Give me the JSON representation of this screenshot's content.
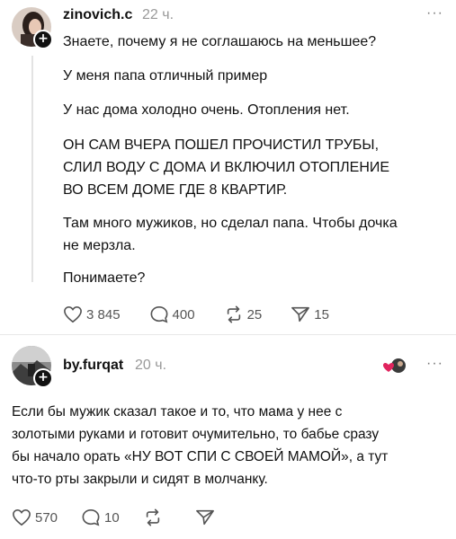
{
  "post1": {
    "username": "zinovich.c",
    "time": "22 ч.",
    "more": "···",
    "lines": [
      "Знаете, почему я не соглашаюсь на меньшее?",
      "У меня папа отличный пример",
      "У нас дома холодно очень. Отопления нет.",
      "ОН САМ ВЧЕРА ПОШЕЛ ПРОЧИСТИЛ ТРУБЫ,",
      "СЛИЛ ВОДУ С ДОМА И ВКЛЮЧИЛ ОТОПЛЕНИЕ",
      "ВО ВСЕМ ДОМЕ ГДЕ 8 КВАРТИР.",
      "Там много мужиков, но сделал папа. Чтобы дочка",
      "не мерзла.",
      "Понимаете?"
    ],
    "likes": "3 845",
    "comments": "400",
    "reposts": "25",
    "shares": "15"
  },
  "post2": {
    "username": "by.furqat",
    "time": "20 ч.",
    "more": "···",
    "lines": [
      "Если бы мужик сказал такое и то, что мама у нее с",
      "золотыми руками и готовит очумительно, то бабье сразу",
      "бы начало орать «НУ ВОТ СПИ С СВОЕЙ МАМОЙ», а тут",
      "что-то рты закрыли и сидят в молчанку."
    ],
    "likes": "570",
    "comments": "10"
  },
  "icons": {
    "follow": "plus-icon",
    "like": "heart-icon",
    "comment": "comment-bubble-icon",
    "repost": "repost-icon",
    "share": "send-icon",
    "liked_by_author": "heart-avatar-icon"
  },
  "colors": {
    "text": "#111111",
    "muted": "#999999",
    "like_red": "#e0245e"
  }
}
